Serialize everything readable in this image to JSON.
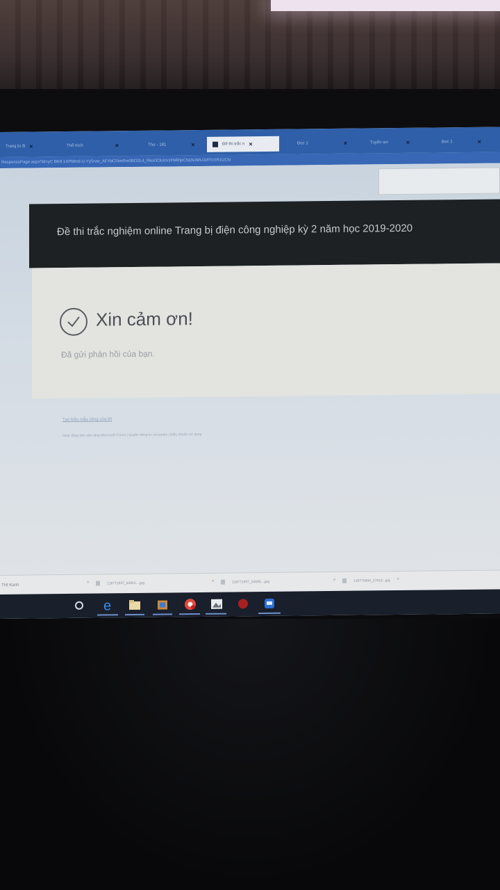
{
  "browser": {
    "tabs": [
      {
        "label": "Trang bị đi"
      },
      {
        "label": "Thể trích"
      },
      {
        "label": "Thư - 181"
      },
      {
        "label": "Đề thi trắc n",
        "active": true
      },
      {
        "label": "Đọc 1"
      },
      {
        "label": "Tuyển sin"
      },
      {
        "label": "Đọc 1"
      }
    ],
    "close_glyph": "×",
    "address": "ResponsePage.aspx?id=yC BK9 1XPMmd-U-Yy5rvw_AFXbC5ImRm5BO2Ld_RkoOOUoVzFMRlpCN1NJMUJzRTc5R1UCN"
  },
  "form": {
    "title": "Đề thi trắc nghiệm online Trang bị điện công nghiệp kỳ 2 năm học 2019-2020",
    "thanks": "Xin cảm ơn!",
    "submitted": "Đã gửi phản hồi của bạn.",
    "create_link": "Tạo biểu mẫu riêng của tôi",
    "footer_note": "Hoạt động trên nền tảng Microsoft Forms | Quyền riêng tư và cookie | Điều khoản sử dụng"
  },
  "downloads": {
    "label": "THỊ Kanh",
    "items": [
      {
        "name": "116771937_63951....jpg"
      },
      {
        "name": "116771937_24005....jpg"
      },
      {
        "name": "116770494_27810...jpg"
      }
    ],
    "chevron": "^"
  },
  "taskbar": {
    "icons": [
      "cortana-icon",
      "edge-icon",
      "file-explorer-icon",
      "store-icon",
      "chrome-icon",
      "photos-icon",
      "app-icon",
      "zalo-icon"
    ]
  },
  "colors": {
    "tab_bar": "#2f5fa8",
    "form_header": "#1d2124",
    "card": "#e3e3e0",
    "taskbar": "#1a1f2c"
  }
}
